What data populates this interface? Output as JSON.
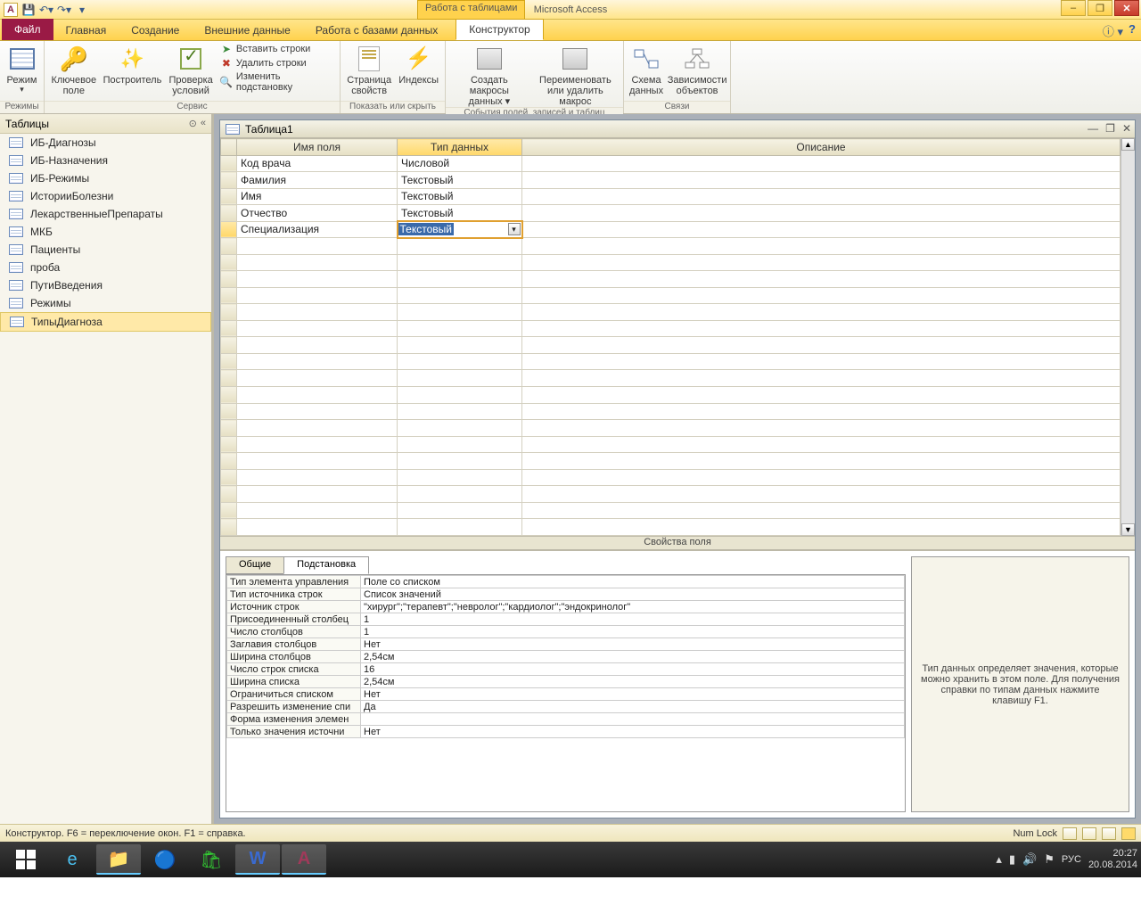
{
  "title": "Microsoft Access",
  "context_tab_group": "Работа с таблицами",
  "window_controls": {
    "min": "–",
    "max": "❐",
    "close": "✕"
  },
  "tabs": {
    "file": "Файл",
    "items": [
      "Главная",
      "Создание",
      "Внешние данные",
      "Работа с базами данных"
    ],
    "context": "Конструктор",
    "help_dd": "ⓘ ▾",
    "help_q": "?"
  },
  "ribbon": {
    "groups": [
      {
        "label": "Режимы",
        "big": [
          {
            "name": "Режим",
            "sub": "▾"
          }
        ]
      },
      {
        "label": "Сервис",
        "big": [
          {
            "name": "Ключевое\nполе"
          },
          {
            "name": "Построитель"
          },
          {
            "name": "Проверка\nусловий"
          }
        ],
        "small": [
          "Вставить строки",
          "Удалить строки",
          "Изменить подстановку"
        ]
      },
      {
        "label": "Показать или скрыть",
        "big": [
          {
            "name": "Страница\nсвойств"
          },
          {
            "name": "Индексы"
          }
        ]
      },
      {
        "label": "События полей, записей и таблиц",
        "big": [
          {
            "name": "Создать макросы\nданных ▾"
          },
          {
            "name": "Переименовать\nили удалить макрос"
          }
        ]
      },
      {
        "label": "Связи",
        "big": [
          {
            "name": "Схема\nданных"
          },
          {
            "name": "Зависимости\nобъектов"
          }
        ]
      }
    ]
  },
  "nav": {
    "header": "Таблицы",
    "items": [
      "ИБ-Диагнозы",
      "ИБ-Назначения",
      "ИБ-Режимы",
      "ИсторииБолезни",
      "ЛекарственныеПрепараты",
      "МКБ",
      "Пациенты",
      "проба",
      "ПутиВведения",
      "Режимы",
      "ТипыДиагноза"
    ],
    "selected_index": 10
  },
  "doc": {
    "title": "Таблица1",
    "columns": [
      "Имя поля",
      "Тип данных",
      "Описание"
    ],
    "rows": [
      {
        "name": "Код врача",
        "type": "Числовой"
      },
      {
        "name": "Фамилия",
        "type": "Текстовый"
      },
      {
        "name": "Имя",
        "type": "Текстовый"
      },
      {
        "name": "Отчество",
        "type": "Текстовый"
      },
      {
        "name": "Специализация",
        "type": "Текстовый",
        "current": true
      }
    ],
    "empty_rows": 18,
    "props_header": "Свойства поля"
  },
  "props": {
    "tabs": [
      "Общие",
      "Подстановка"
    ],
    "active_tab": 1,
    "rows": [
      [
        "Тип элемента управления",
        "Поле со списком"
      ],
      [
        "Тип источника строк",
        "Список значений"
      ],
      [
        "Источник строк",
        "\"хирург\";\"терапевт\";\"невролог\";\"кардиолог\";\"эндокринолог\""
      ],
      [
        "Присоединенный столбец",
        "1"
      ],
      [
        "Число столбцов",
        "1"
      ],
      [
        "Заглавия столбцов",
        "Нет"
      ],
      [
        "Ширина столбцов",
        "2,54см"
      ],
      [
        "Число строк списка",
        "16"
      ],
      [
        "Ширина списка",
        "2,54см"
      ],
      [
        "Ограничиться списком",
        "Нет"
      ],
      [
        "Разрешить изменение спи",
        "Да"
      ],
      [
        "Форма изменения элемен",
        ""
      ],
      [
        "Только значения источни",
        "Нет"
      ]
    ],
    "help": "Тип данных определяет значения, которые можно хранить в этом поле. Для получения справки по типам данных нажмите клавишу F1."
  },
  "status": {
    "left": "Конструктор.  F6 = переключение окон.  F1 = справка.",
    "numlock": "Num Lock"
  },
  "taskbar": {
    "lang": "РУС",
    "time": "20:27",
    "date": "20.08.2014"
  }
}
